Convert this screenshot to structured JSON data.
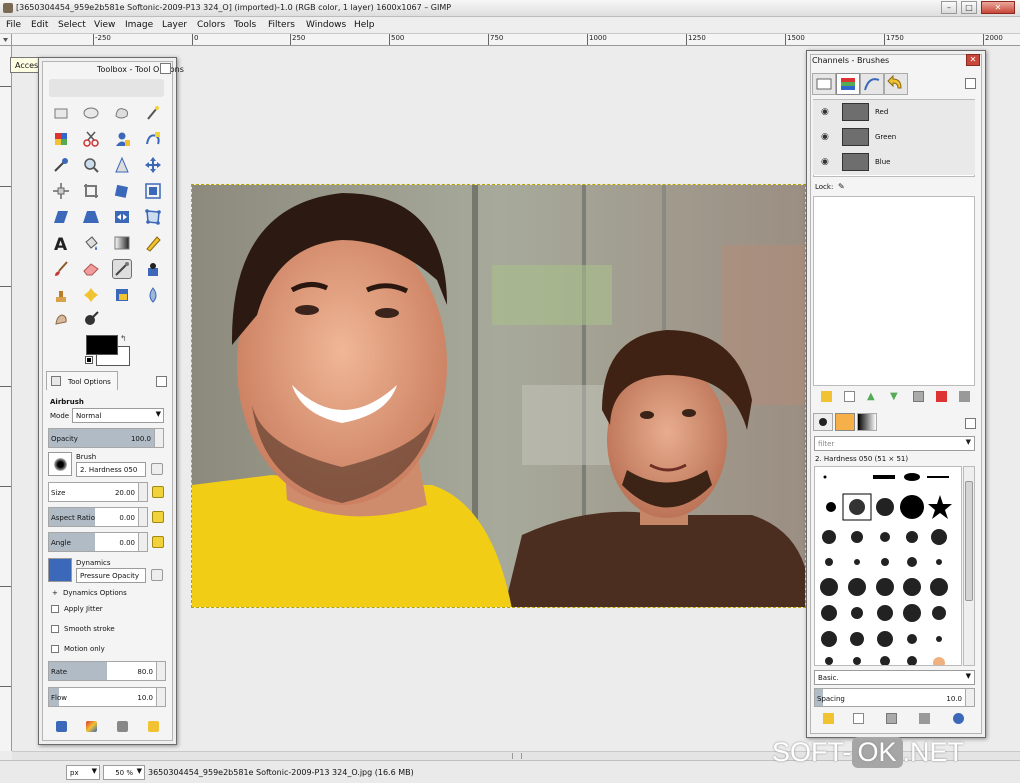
{
  "window": {
    "title": "[3650304454_959e2b581e Softonic-2009-P13 324_O] (imported)-1.0 (RGB color, 1 layer) 1600x1067 – GIMP",
    "minimize": "–",
    "maximize": "□",
    "close": "✕"
  },
  "menubar": [
    "File",
    "Edit",
    "Select",
    "View",
    "Image",
    "Layer",
    "Colors",
    "Tools",
    "Filters",
    "Windows",
    "Help"
  ],
  "ruler_labels": [
    "-250",
    "0",
    "250",
    "500",
    "750",
    "1000",
    "1250",
    "1500",
    "1750",
    "2000"
  ],
  "tooltip": "Access the image menu",
  "toolbox": {
    "title": "Toolbox - Tool Options",
    "tool_options_tab": "Tool Options",
    "tool_name": "Airbrush",
    "mode_label": "Mode",
    "mode_value": "Normal",
    "opacity_label": "Opacity",
    "opacity_value": "100.0",
    "brush_label": "Brush",
    "brush_value": "2. Hardness 050",
    "size_label": "Size",
    "size_value": "20.00",
    "aspect_label": "Aspect Ratio",
    "aspect_value": "0.00",
    "angle_label": "Angle",
    "angle_value": "0.00",
    "dynamics_label": "Dynamics",
    "dynamics_value": "Pressure Opacity",
    "dynamics_options": "Dynamics Options",
    "apply_jitter": "Apply Jitter",
    "smooth_stroke": "Smooth stroke",
    "motion_only": "Motion only",
    "rate_label": "Rate",
    "rate_value": "80.0",
    "flow_label": "Flow",
    "flow_value": "10.0"
  },
  "dock": {
    "title": "Channels - Brushes",
    "channels": [
      {
        "name": "Red"
      },
      {
        "name": "Green"
      },
      {
        "name": "Blue"
      }
    ],
    "lock_label": "Lock:",
    "filter_placeholder": "filter",
    "brush_name": "2. Hardness 050 (51 × 51)",
    "preset": "Basic.",
    "spacing_label": "Spacing",
    "spacing_value": "10.0"
  },
  "statusbar": {
    "unit": "px",
    "zoom": "50 %",
    "info": "3650304454_959e2b581e Softonic-2009-P13 324_O.jpg (16.6 MB)"
  },
  "watermark": {
    "left": "SOFT-",
    "ok": "OK",
    "right": ".NET"
  }
}
